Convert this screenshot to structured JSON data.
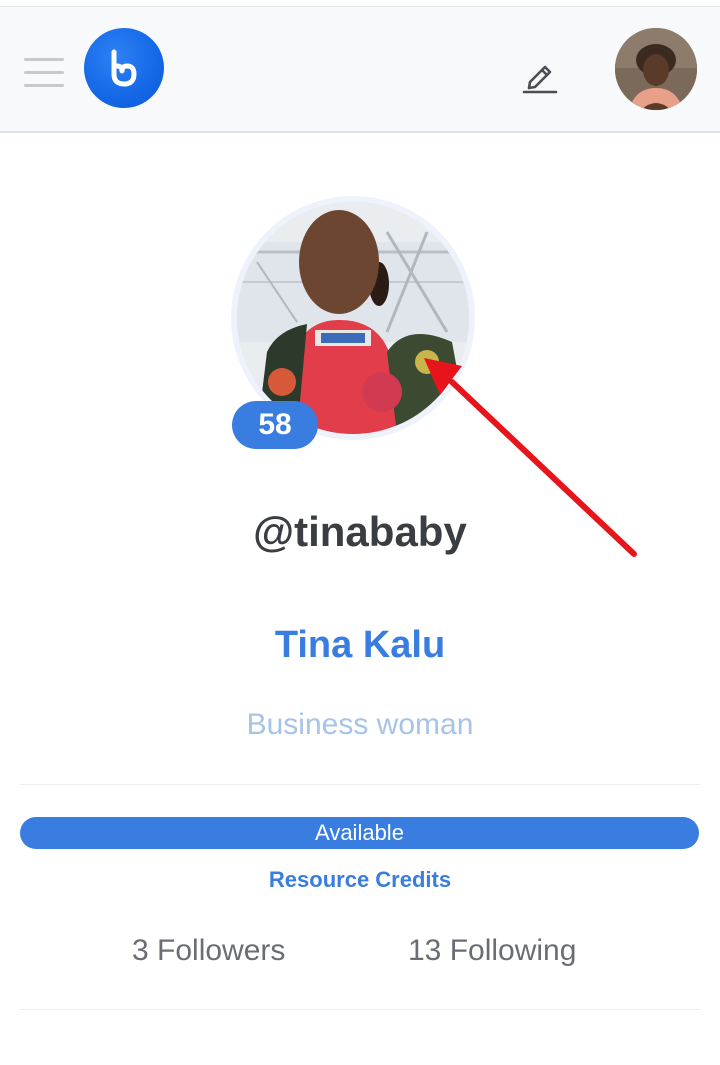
{
  "header": {
    "menu_icon": "hamburger-icon",
    "logo_icon": "heart-logo-icon",
    "edit_icon": "pencil-icon",
    "avatar_icon": "user-avatar"
  },
  "profile": {
    "score": "58",
    "username": "@tinababy",
    "full_name": "Tina Kalu",
    "bio": "Business woman",
    "status": "Available",
    "resource_credits_label": "Resource Credits",
    "followers": "3 Followers",
    "following": "13 Following"
  },
  "colors": {
    "accent": "#3a7de0",
    "logo": "#1467e6",
    "annotation_arrow": "#e8141b",
    "bio": "#a8c3e8",
    "muted_text": "#6a6e74"
  }
}
